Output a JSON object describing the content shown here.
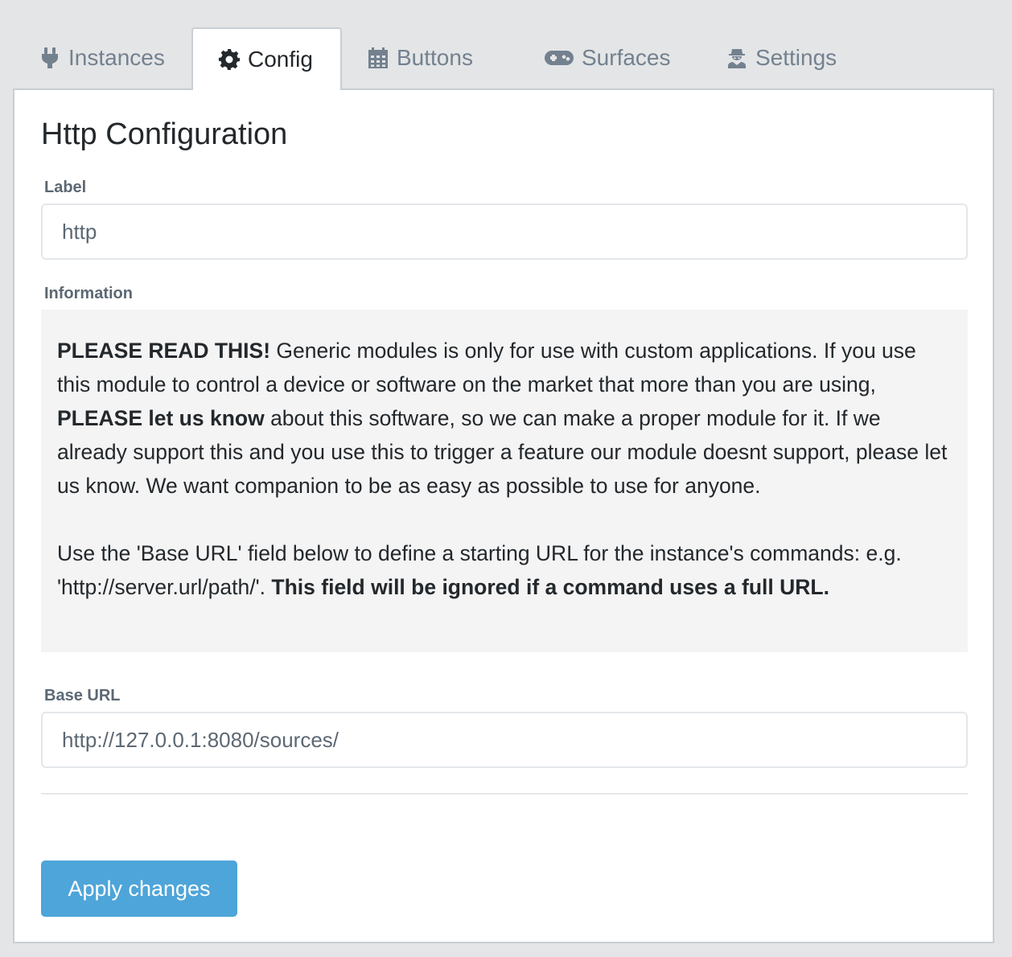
{
  "tabs": {
    "instances": {
      "label": "Instances",
      "icon": "plug-icon"
    },
    "config": {
      "label": "Config",
      "icon": "gear-icon"
    },
    "buttons": {
      "label": "Buttons",
      "icon": "calendar-grid-icon"
    },
    "surfaces": {
      "label": "Surfaces",
      "icon": "gamepad-icon"
    },
    "settings": {
      "label": "Settings",
      "icon": "user-secret-icon"
    },
    "active": "config"
  },
  "config": {
    "title": "Http Configuration",
    "label_field": {
      "label": "Label",
      "value": "http"
    },
    "information": {
      "label": "Information",
      "p1_bold1": "PLEASE READ THIS!",
      "p1_text1": " Generic modules is only for use with custom applications. If you use this module to control a device or software on the market that more than you are using, ",
      "p1_bold2": "PLEASE let us know",
      "p1_text2": " about this software, so we can make a proper module for it. If we already support this and you use this to trigger a feature our module doesnt support, please let us know. We want companion to be as easy as possible to use for anyone.",
      "p2_text": "Use the 'Base URL' field below to define a starting URL for the instance's commands: e.g. 'http://server.url/path/'. ",
      "p2_bold": "This field will be ignored if a command uses a full URL."
    },
    "base_url_field": {
      "label": "Base URL",
      "value": "http://127.0.0.1:8080/sources/"
    },
    "apply_label": "Apply changes"
  },
  "colors": {
    "background": "#e4e5e6",
    "panel": "#ffffff",
    "info_bg": "#f4f4f4",
    "apply_button": "#4ea5d9",
    "tab_inactive_text": "#73818f"
  }
}
